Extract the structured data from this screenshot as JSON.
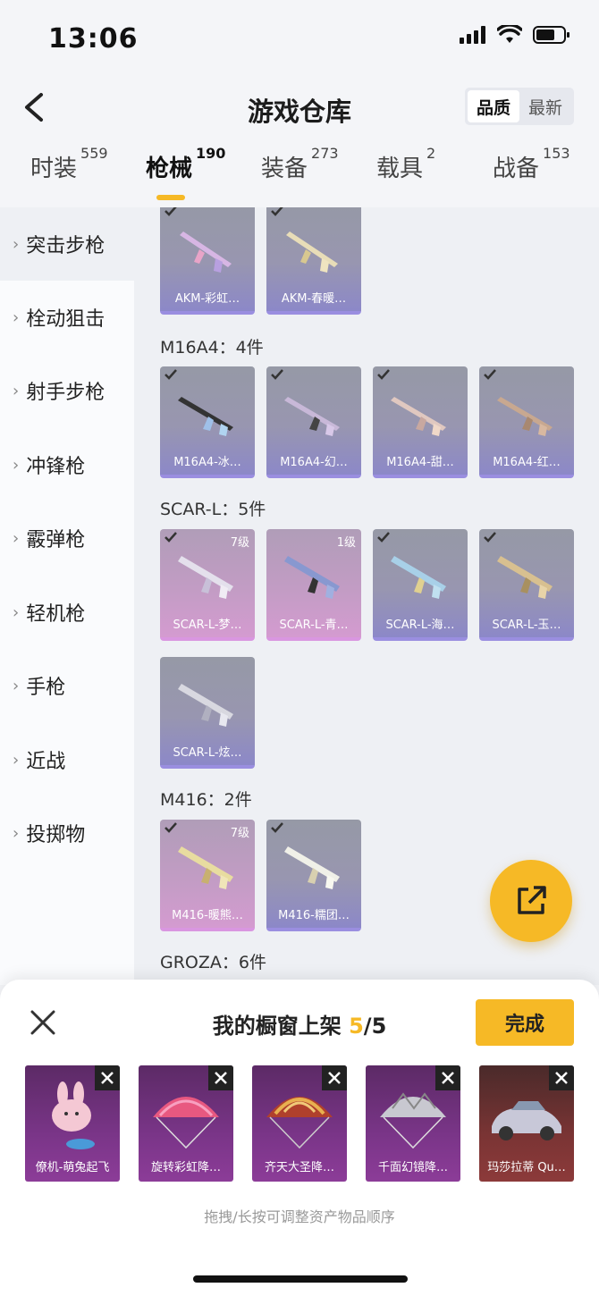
{
  "status": {
    "time": "13:06"
  },
  "header": {
    "title": "游戏仓库",
    "sort_quality": "品质",
    "sort_latest": "最新"
  },
  "tabs": [
    {
      "label": "时装",
      "count": "559"
    },
    {
      "label": "枪械",
      "count": "190"
    },
    {
      "label": "装备",
      "count": "273"
    },
    {
      "label": "载具",
      "count": "2"
    },
    {
      "label": "战备",
      "count": "153"
    }
  ],
  "sidebar": [
    "突击步枪",
    "栓动狙击",
    "射手步枪",
    "冲锋枪",
    "霰弹枪",
    "轻机枪",
    "手枪",
    "近战",
    "投掷物"
  ],
  "groups": [
    {
      "label": "M16A4：4件"
    },
    {
      "label": "SCAR-L：5件"
    },
    {
      "label": "M416：2件"
    },
    {
      "label": "GROZA：6件"
    }
  ],
  "cards": {
    "akm1": {
      "name": "AKM-彩虹…"
    },
    "akm2": {
      "name": "AKM-春暖…"
    },
    "m16a": {
      "name": "M16A4-冰…"
    },
    "m16b": {
      "name": "M16A4-幻…"
    },
    "m16c": {
      "name": "M16A4-甜…"
    },
    "m16d": {
      "name": "M16A4-红…"
    },
    "scar1": {
      "name": "SCAR-L-梦…",
      "level": "7级"
    },
    "scar2": {
      "name": "SCAR-L-青…",
      "level": "1级"
    },
    "scar3": {
      "name": "SCAR-L-海…"
    },
    "scar4": {
      "name": "SCAR-L-玉…"
    },
    "scar5": {
      "name": "SCAR-L-炫…"
    },
    "m4161": {
      "name": "M416-暖熊…",
      "level": "7级"
    },
    "m4162": {
      "name": "M416-糯团…"
    }
  },
  "sheet": {
    "title_prefix": "我的橱窗上架",
    "count_current": "5",
    "count_total": "/5",
    "done": "完成",
    "items": [
      {
        "name": "僚机-萌兔起飞"
      },
      {
        "name": "旋转彩虹降…"
      },
      {
        "name": "齐天大圣降…"
      },
      {
        "name": "千面幻镜降…"
      },
      {
        "name": "玛莎拉蒂 Qu…"
      }
    ],
    "hint": "拖拽/长按可调整资产物品顺序"
  },
  "colors": {
    "accent": "#f6b926",
    "card_blue": "#9896b0",
    "card_pink": "#c29cc4",
    "shelf_purple": "#7a3588"
  }
}
